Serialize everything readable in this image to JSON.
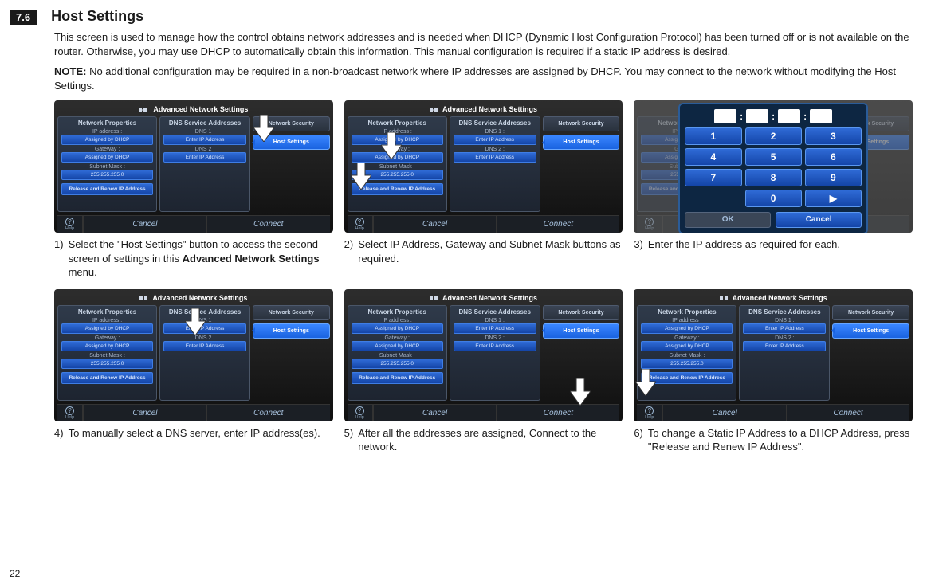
{
  "section_number": "7.6",
  "title": "Host Settings",
  "intro": "This screen is used to manage how the control obtains network addresses and is needed when DHCP (Dynamic Host Configuration Protocol) has been turned off or is not available on the router. Otherwise, you may use DHCP to automatically obtain this information. This manual configuration is required if a static IP address is desired.",
  "note_label": "NOTE:",
  "note_text": " No additional configuration may be required in a non-broadcast network where IP addresses are assigned by DHCP. You may connect to the network without modifying the Host Settings.",
  "page_number": "22",
  "screen": {
    "title": "Advanced Network Settings",
    "left_header": "Network Properties",
    "mid_header": "DNS Service Addresses",
    "lbl_ip": "IP address :",
    "lbl_gw": "Gateway :",
    "lbl_sm": "Subnet Mask :",
    "val_dhcp": "Assigned by DHCP",
    "val_subnet": "255.255.255.0",
    "lbl_dns1": "DNS 1 :",
    "lbl_dns2": "DNS 2 :",
    "val_enter": "Enter IP Address",
    "btn_renew": "Release and Renew IP Address",
    "tab_netsec": "Network Security",
    "tab_host": "Host Settings",
    "btn_help": "Help",
    "btn_cancel": "Cancel",
    "btn_connect": "Connect"
  },
  "keypad": {
    "keys": [
      "1",
      "2",
      "3",
      "4",
      "5",
      "6",
      "7",
      "8",
      "9",
      "",
      "0",
      "▶"
    ],
    "ok": "OK",
    "cancel": "Cancel"
  },
  "captions": {
    "1": {
      "num": "1)",
      "pre": "Select the \"Host Settings\" button to access the second screen of settings in this ",
      "bold": "Advanced Network Settings",
      "post": " menu."
    },
    "2": {
      "num": "2)",
      "text": "Select IP Address, Gateway and Subnet Mask buttons as required."
    },
    "3": {
      "num": "3)",
      "text": "Enter the IP address as required for each."
    },
    "4": {
      "num": "4)",
      "text": "To manually select a DNS server, enter IP address(es)."
    },
    "5": {
      "num": "5)",
      "text": "After all the addresses are assigned, Connect to the network."
    },
    "6": {
      "num": "6)",
      "text": "To change a Static IP Address to a DHCP Address, press \"Release and Renew IP Address\"."
    }
  }
}
